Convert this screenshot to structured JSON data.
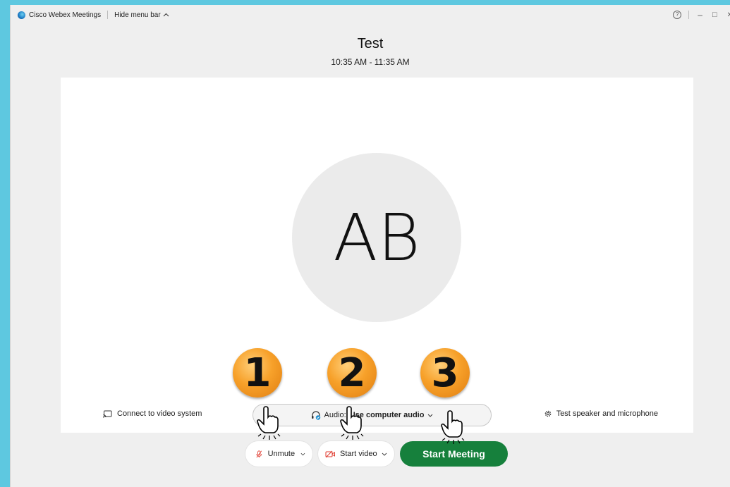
{
  "titlebar": {
    "app_name": "Cisco Webex Meetings",
    "hide_menu_label": "Hide menu bar",
    "help_glyph": "?",
    "minimize_glyph": "–",
    "maximize_glyph": "□",
    "close_glyph": "✕"
  },
  "meeting": {
    "title": "Test",
    "time": "10:35 AM - 11:35 AM"
  },
  "preview": {
    "avatar_initials": "AB",
    "connect_label": "Connect to video system",
    "audio_prefix": "Audio:",
    "audio_value": "Use computer audio",
    "test_speaker_label": "Test speaker and microphone"
  },
  "controls": {
    "unmute_label": "Unmute",
    "start_video_label": "Start video",
    "start_meeting_label": "Start Meeting"
  },
  "annotations": {
    "step1": "1",
    "step2": "2",
    "step3": "3"
  },
  "colors": {
    "start_meeting_bg": "#16803c",
    "badge_orange": "#f7a12a",
    "mute_red": "#e03b2f",
    "background": "#5ec8e0"
  },
  "icons": [
    "webex-logo-icon",
    "chevron-up-icon",
    "help-icon",
    "cast-icon",
    "headset-icon",
    "gear-icon",
    "mic-muted-icon",
    "video-off-icon",
    "chevron-down-icon",
    "pointing-hand-icon"
  ]
}
